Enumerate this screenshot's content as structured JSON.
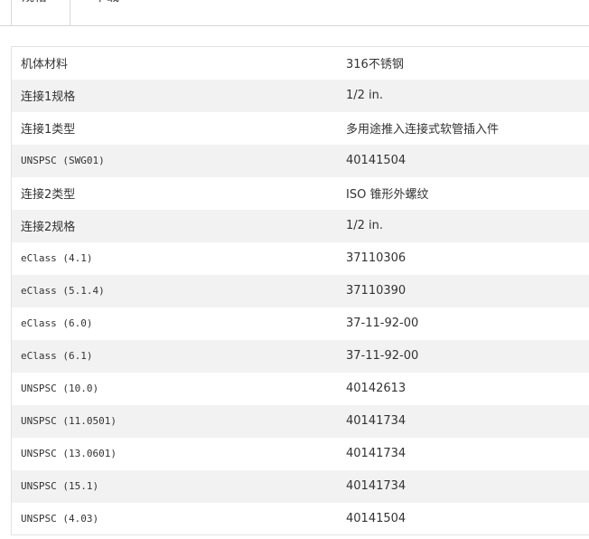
{
  "tabs": [
    {
      "label": "规格",
      "active": true
    },
    {
      "label": "下载",
      "active": false
    }
  ],
  "specs": [
    {
      "key": "机体材料",
      "value": "316不锈钢"
    },
    {
      "key": "连接1规格",
      "value": "1/2 in."
    },
    {
      "key": "连接1类型",
      "value": "多用途推入连接式软管插入件"
    },
    {
      "key": "UNSPSC (SWG01)",
      "value": "40141504"
    },
    {
      "key": "连接2类型",
      "value": "ISO 锥形外螺纹"
    },
    {
      "key": "连接2规格",
      "value": "1/2 in."
    },
    {
      "key": "eClass (4.1)",
      "value": "37110306"
    },
    {
      "key": "eClass (5.1.4)",
      "value": "37110390"
    },
    {
      "key": "eClass (6.0)",
      "value": "37-11-92-00"
    },
    {
      "key": "eClass (6.1)",
      "value": "37-11-92-00"
    },
    {
      "key": "UNSPSC (10.0)",
      "value": "40142613"
    },
    {
      "key": "UNSPSC (11.0501)",
      "value": "40141734"
    },
    {
      "key": "UNSPSC (13.0601)",
      "value": "40141734"
    },
    {
      "key": "UNSPSC (15.1)",
      "value": "40141734"
    },
    {
      "key": "UNSPSC (4.03)",
      "value": "40141504"
    }
  ]
}
